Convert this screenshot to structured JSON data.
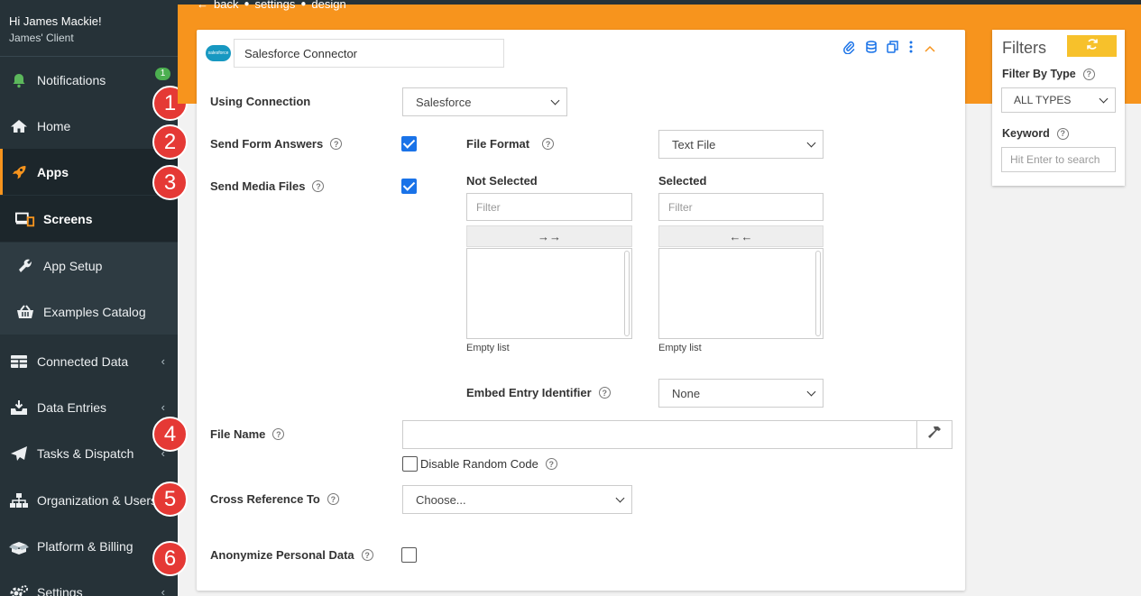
{
  "user": {
    "greeting": "Hi James Mackie!",
    "client": "James' Client"
  },
  "sidebar": {
    "items": [
      {
        "label": "Notifications",
        "badge": "1"
      },
      {
        "label": "Home"
      },
      {
        "label": "Apps"
      },
      {
        "label": "Screens"
      },
      {
        "label": "App Setup"
      },
      {
        "label": "Examples Catalog"
      },
      {
        "label": "Connected Data"
      },
      {
        "label": "Data Entries"
      },
      {
        "label": "Tasks & Dispatch"
      },
      {
        "label": "Organization & Users"
      },
      {
        "label": "Platform & Billing"
      },
      {
        "label": "Settings"
      }
    ]
  },
  "breadcrumb": {
    "back": "back",
    "settings": "settings",
    "design": "design"
  },
  "connector": {
    "logo_text": "salesforce",
    "name": "Salesforce Connector",
    "using_connection_label": "Using Connection",
    "using_connection_value": "Salesforce",
    "send_form_answers_label": "Send Form Answers",
    "send_media_files_label": "Send Media Files",
    "file_format_label": "File Format",
    "file_format_value": "Text File",
    "not_selected_label": "Not Selected",
    "selected_label": "Selected",
    "filter_placeholder": "Filter",
    "move_right": "→→",
    "move_left": "←←",
    "empty_list": "Empty list",
    "embed_entry_label": "Embed Entry Identifier",
    "embed_entry_value": "None",
    "file_name_label": "File Name",
    "disable_random_code": "Disable Random Code",
    "cross_ref_label": "Cross Reference To",
    "cross_ref_value": "Choose...",
    "anonymize_label": "Anonymize Personal Data"
  },
  "filters": {
    "title": "Filters",
    "filter_by_type_label": "Filter By Type",
    "filter_by_type_value": "ALL TYPES",
    "keyword_label": "Keyword",
    "keyword_placeholder": "Hit Enter to search"
  },
  "steps": [
    "1",
    "2",
    "3",
    "4",
    "5",
    "6"
  ],
  "colors": {
    "accent": "#f7941d",
    "sidebar": "#263238",
    "checkbox": "#1a73e8",
    "step": "#e53935",
    "badge": "#4caf50"
  }
}
